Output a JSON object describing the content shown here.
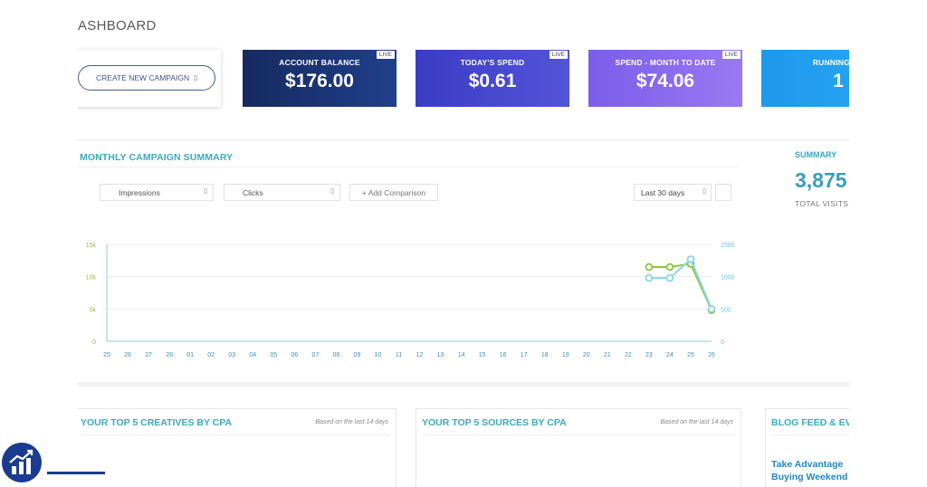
{
  "dashboard": {
    "title": "ASHBOARD"
  },
  "create_campaign": {
    "label": "CREATE NEW CAMPAIGN",
    "icon": "calendar-icon"
  },
  "stats": [
    {
      "label": "ACCOUNT BALANCE",
      "value": "$176.00",
      "badge": "LIVE",
      "color": "#1b3572"
    },
    {
      "label": "TODAY'S SPEND",
      "value": "$0.61",
      "badge": "LIVE",
      "color": "#4446cf"
    },
    {
      "label": "SPEND - MONTH TO DATE",
      "value": "$74.06",
      "badge": "LIVE",
      "color": "#8a6bee"
    },
    {
      "label": "RUNNING CA",
      "value": "1",
      "badge": "",
      "color": "#25a2f0"
    }
  ],
  "monthly": {
    "title": "MONTHLY CAMPAIGN SUMMARY",
    "metric1": "Impressions",
    "metric2": "Clicks",
    "add_comparison": "+ Add Comparison",
    "date_range": "Last 30 days"
  },
  "summary": {
    "label": "SUMMARY",
    "value": "3,875",
    "sub": "TOTAL VISITS"
  },
  "chart_data": {
    "type": "line",
    "x": [
      "25",
      "26",
      "27",
      "28",
      "01",
      "02",
      "03",
      "04",
      "05",
      "06",
      "07",
      "08",
      "09",
      "10",
      "11",
      "12",
      "13",
      "14",
      "15",
      "16",
      "17",
      "18",
      "19",
      "20",
      "21",
      "22",
      "23",
      "24",
      "25",
      "26"
    ],
    "left_axis": {
      "ticks": [
        "0",
        "5k",
        "10k",
        "15k"
      ],
      "ylim": [
        0,
        15000
      ]
    },
    "right_axis": {
      "ticks": [
        "0",
        "500",
        "1000",
        "1500"
      ],
      "ylim": [
        0,
        1500
      ]
    },
    "series": [
      {
        "axis": "left",
        "color": "#8dc63f",
        "start_index": 26,
        "values": [
          11500,
          11500,
          12000,
          4800
        ]
      },
      {
        "axis": "right",
        "color": "#8fd3ec",
        "start_index": 26,
        "values": [
          980,
          980,
          1270,
          500
        ]
      }
    ],
    "grid": true
  },
  "panels": [
    {
      "title": "YOUR TOP 5 CREATIVES BY CPA",
      "note": "Based on the last 14 days"
    },
    {
      "title": "YOUR TOP 5 SOURCES BY CPA",
      "note": "Based on the last 14 days"
    },
    {
      "title": "BLOG FEED & EV",
      "note": ""
    }
  ],
  "blog": {
    "line1": "Take Advantage",
    "line2": "Buying Weekend"
  },
  "logo": {
    "icon": "bar-chart-growth-icon"
  }
}
